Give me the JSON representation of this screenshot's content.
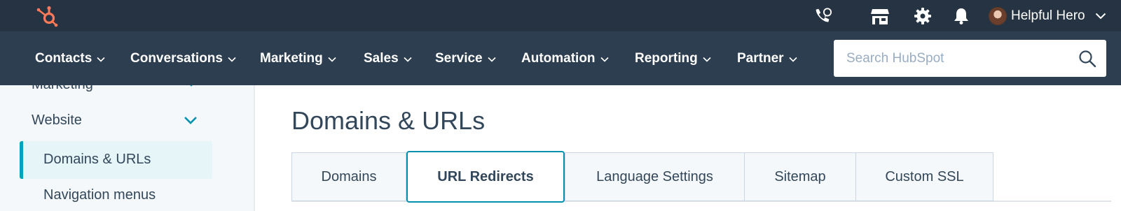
{
  "topbar": {
    "brand_color": "#ff7a59",
    "icons": [
      "hubspot-logo",
      "calling-icon",
      "marketplace-icon",
      "settings-gear-icon",
      "notifications-bell-icon"
    ],
    "user": {
      "name": "Helpful Hero"
    }
  },
  "nav": {
    "items": [
      {
        "label": "Contacts"
      },
      {
        "label": "Conversations"
      },
      {
        "label": "Marketing"
      },
      {
        "label": "Sales"
      },
      {
        "label": "Service"
      },
      {
        "label": "Automation"
      },
      {
        "label": "Reporting"
      },
      {
        "label": "Partner"
      }
    ],
    "search": {
      "placeholder": "Search HubSpot",
      "value": ""
    }
  },
  "sidebar": {
    "cutoff_item": "Marketing",
    "group": "Website",
    "items": [
      {
        "label": "Domains & URLs",
        "active": true
      },
      {
        "label": "Navigation menus",
        "active": false
      }
    ],
    "accent_color": "#00a4bd"
  },
  "main": {
    "title": "Domains & URLs",
    "tabs": [
      {
        "label": "Domains",
        "active": false
      },
      {
        "label": "URL Redirects",
        "active": true
      },
      {
        "label": "Language Settings",
        "active": false
      },
      {
        "label": "Sitemap",
        "active": false
      },
      {
        "label": "Custom SSL",
        "active": false
      }
    ],
    "active_tab_border_color": "#0091ae"
  }
}
